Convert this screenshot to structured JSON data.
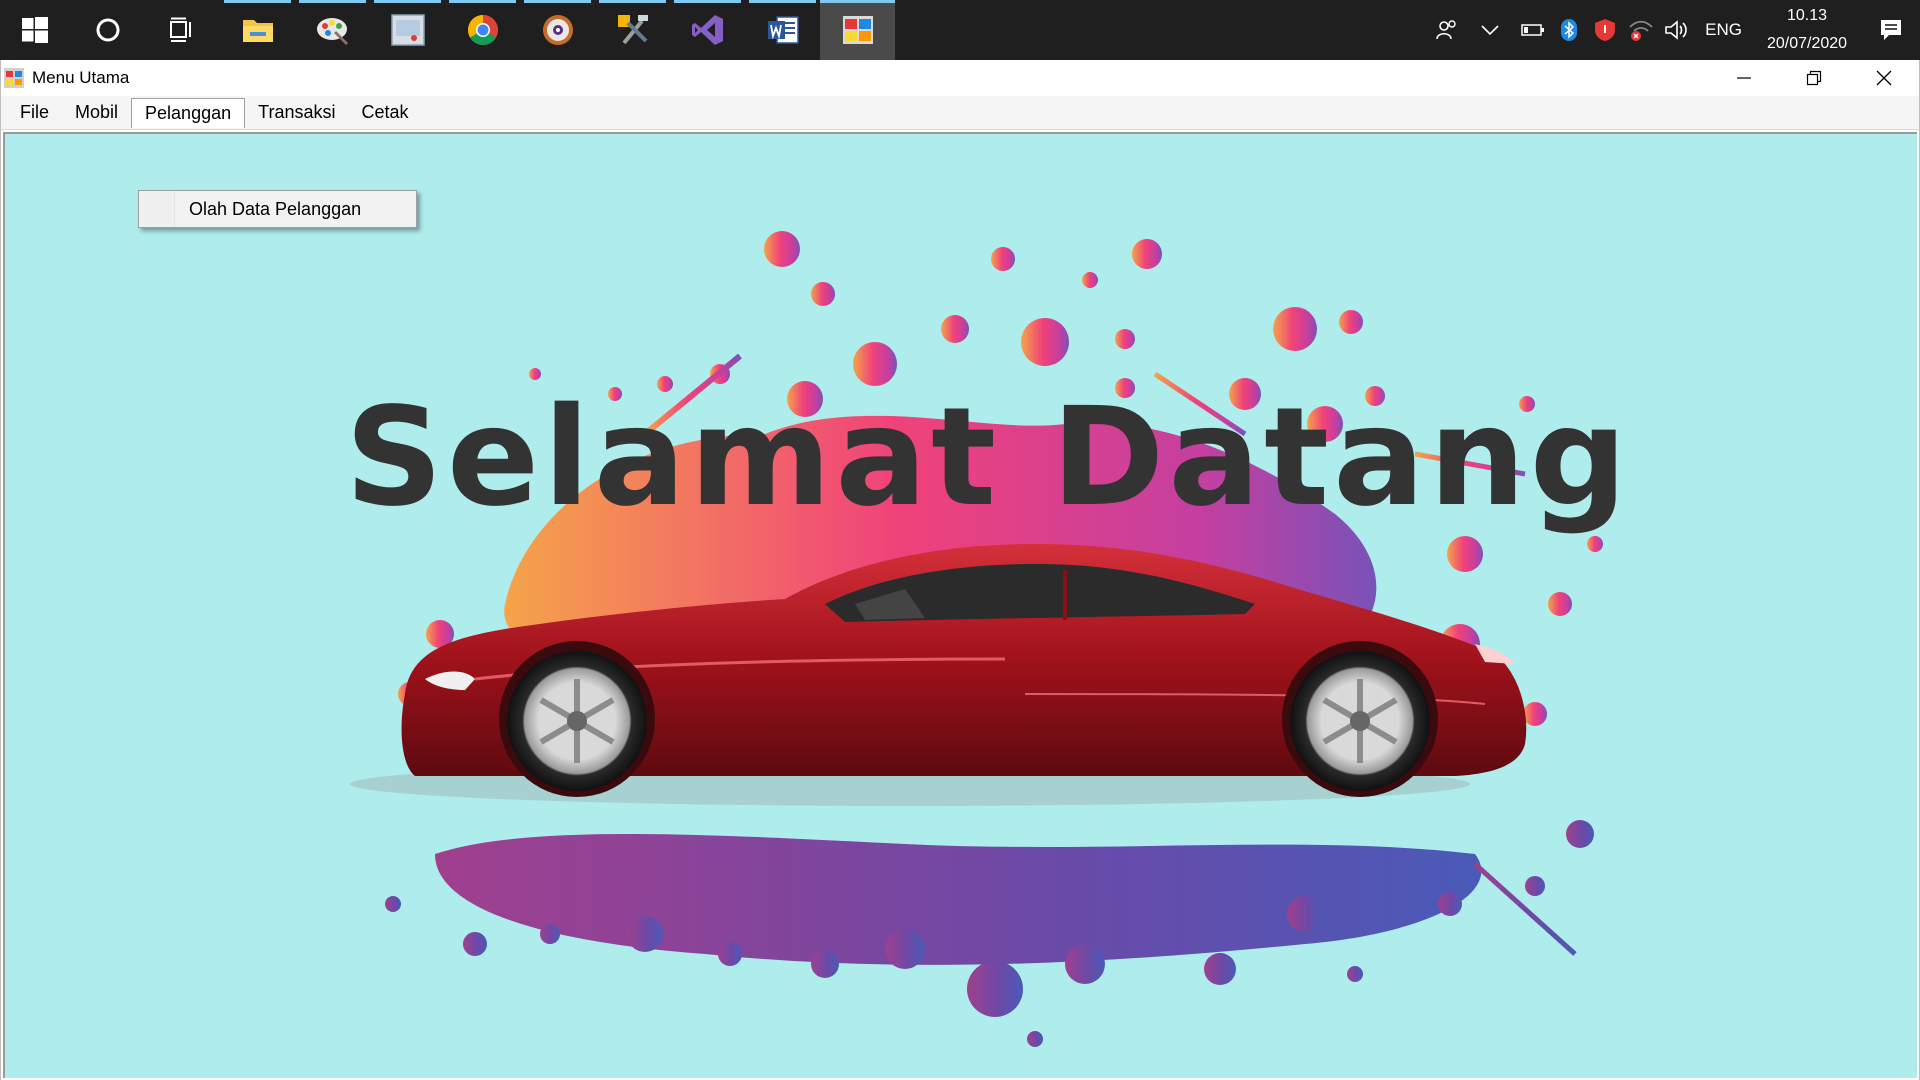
{
  "taskbar": {
    "apps": [
      {
        "name": "task-view-icon"
      },
      {
        "name": "file-explorer-icon"
      },
      {
        "name": "paint-icon"
      },
      {
        "name": "remote-desktop-icon"
      },
      {
        "name": "chrome-icon"
      },
      {
        "name": "media-player-icon"
      },
      {
        "name": "tools-icon"
      },
      {
        "name": "visual-studio-icon"
      },
      {
        "name": "word-icon"
      },
      {
        "name": "menu-utama-app-icon"
      }
    ],
    "tray": {
      "lang": "ENG",
      "time": "10.13",
      "date": "20/07/2020"
    }
  },
  "window": {
    "title": "Menu Utama",
    "menu": [
      "File",
      "Mobil",
      "Pelanggan",
      "Transaksi",
      "Cetak"
    ],
    "open_menu_index": 2,
    "dropdown_items": [
      "Olah Data Pelanggan"
    ]
  },
  "content": {
    "welcome": "Selamat Datang",
    "background_color": "#afecec",
    "car_color": "#a0121b"
  }
}
